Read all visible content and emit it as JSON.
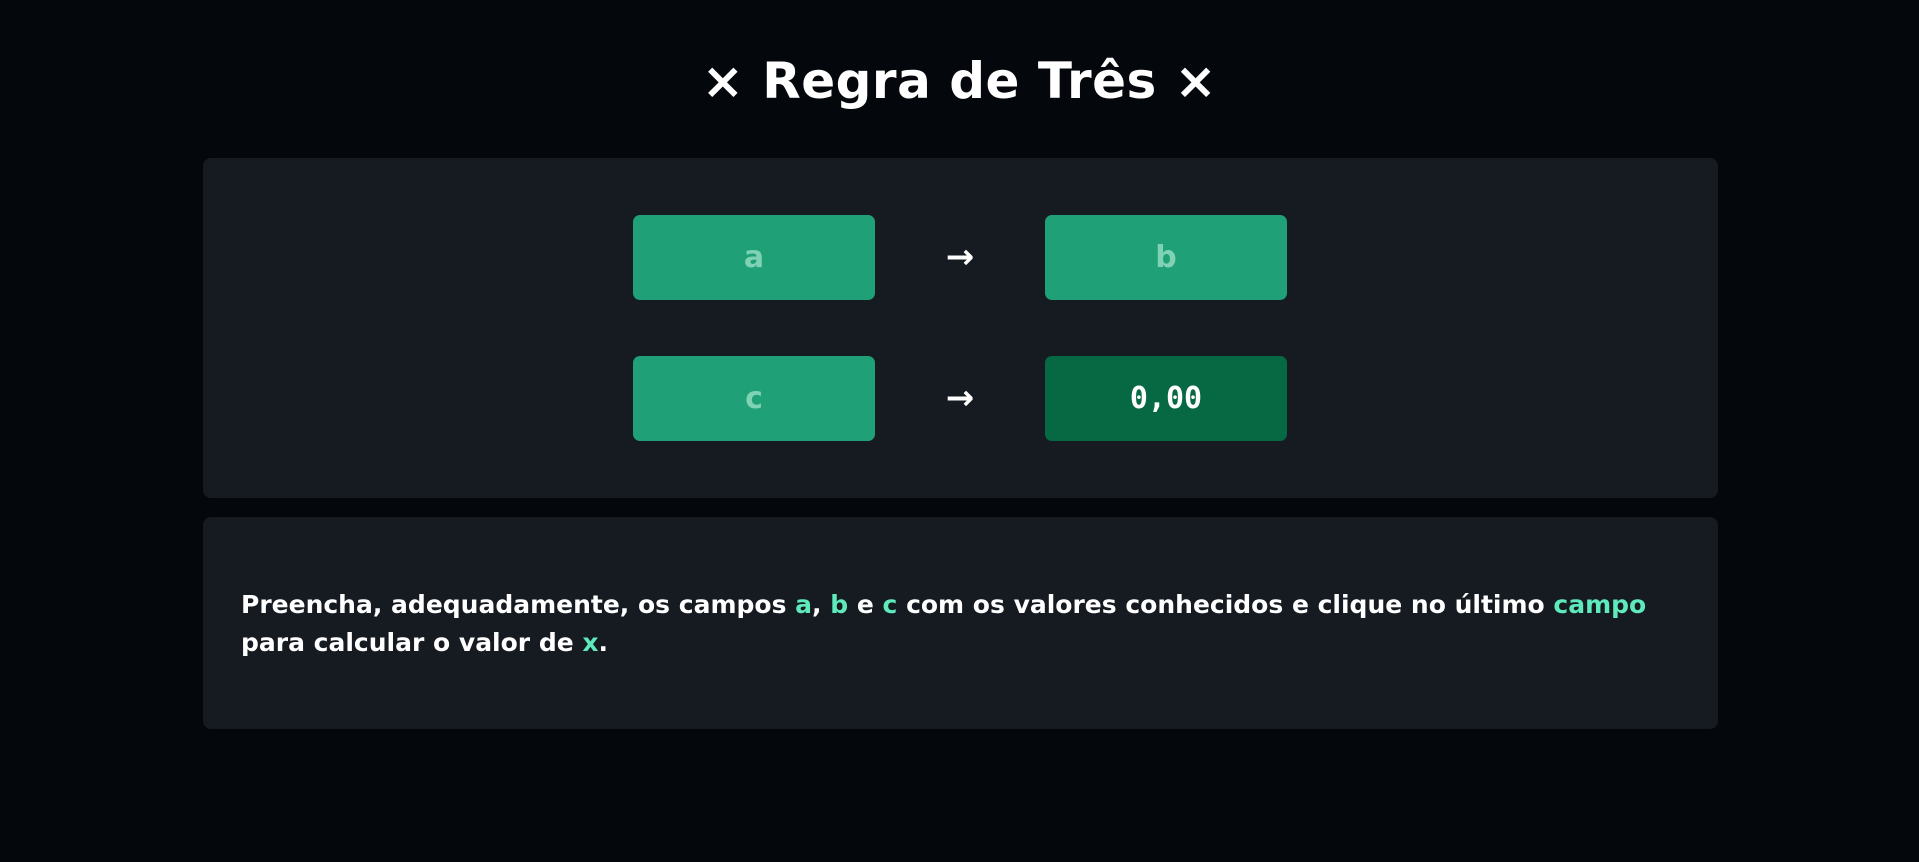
{
  "title": "× Regra de Três ×",
  "fields": {
    "a_placeholder": "a",
    "b_placeholder": "b",
    "c_placeholder": "c",
    "x_value": "0,00"
  },
  "arrows": {
    "row1": "→",
    "row2": "→"
  },
  "info": {
    "part1": "Preencha, adequadamente, os campos ",
    "a": "a",
    "part2": ", ",
    "b": "b",
    "part3": " e ",
    "c": "c",
    "part4": " com os valores conhecidos e clique no último ",
    "campo": "campo",
    "part5": " para calcular o valor de ",
    "x": "x",
    "part6": "."
  },
  "colors": {
    "background": "#04070c",
    "panel": "#161b22",
    "field": "#1fa077",
    "result_field": "#076944",
    "highlight": "#5eeabb"
  }
}
